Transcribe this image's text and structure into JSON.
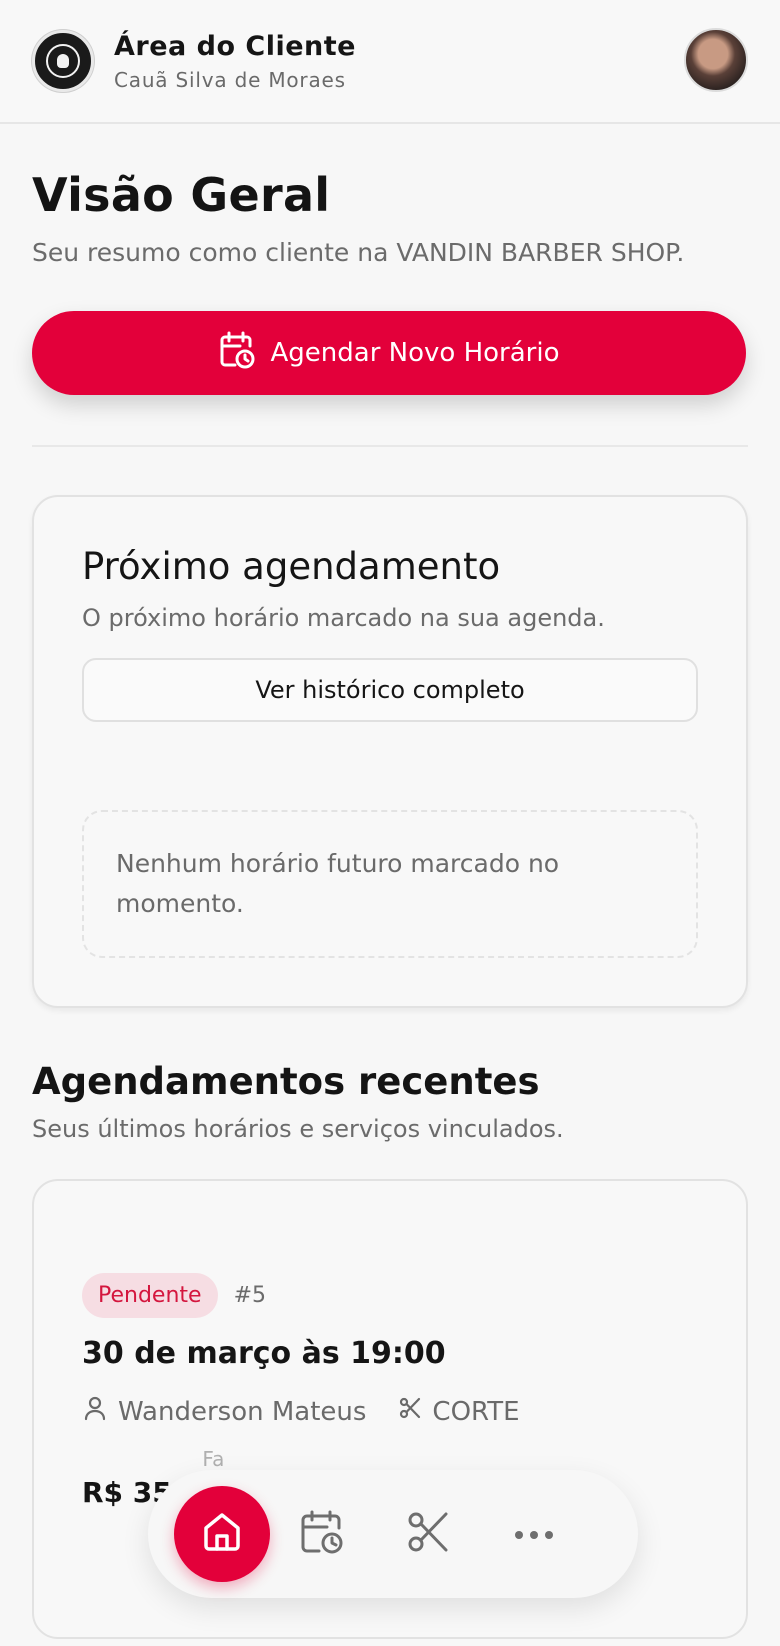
{
  "header": {
    "title": "Área do Cliente",
    "subtitle": "Cauã Silva de Moraes",
    "logo_icon": "barbershop-logo-icon",
    "avatar_icon": "user-avatar"
  },
  "main": {
    "title": "Visão Geral",
    "subtitle": "Seu resumo como cliente na VANDIN BARBER SHOP.",
    "cta_label": "Agendar Novo Horário"
  },
  "next_appointment": {
    "title": "Próximo agendamento",
    "subtitle": "O próximo horário marcado na sua agenda.",
    "history_button": "Ver histórico completo",
    "empty_message": "Nenhum horário futuro marcado no momento."
  },
  "recent": {
    "title": "Agendamentos recentes",
    "subtitle": "Seus últimos horários e serviços vinculados.",
    "items": [
      {
        "status": "Pendente",
        "id": "#5",
        "datetime": "30 de março às 19:00",
        "barber": "Wanderson Mateus",
        "service": "CORTE",
        "price": "R$ 35,",
        "faded_label": "Fa"
      }
    ]
  },
  "bottom_nav": {
    "items": [
      "home-icon",
      "calendar-clock-icon",
      "scissors-icon",
      "more-icon"
    ],
    "active": "home-icon"
  },
  "colors": {
    "accent": "#e3003a",
    "badge_bg": "#f6dde3",
    "badge_text": "#d4163e"
  }
}
